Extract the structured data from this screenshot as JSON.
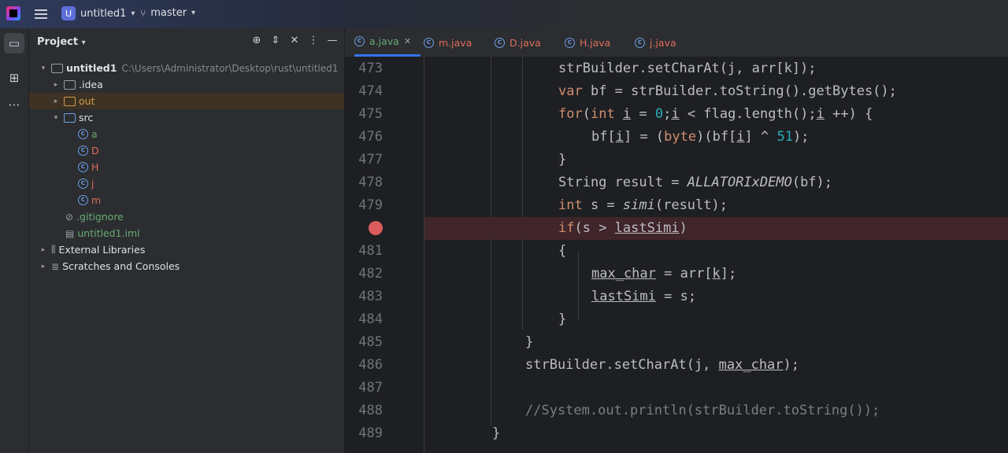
{
  "titlebar": {
    "project_badge": "U",
    "project_name": "untitled1",
    "branch": "master"
  },
  "project_panel": {
    "title": "Project",
    "tree": [
      {
        "label": "untitled1",
        "path": "C:\\Users\\Administrator\\Desktop\\rust\\untitled1",
        "icon": "module-folder-icon",
        "color": "#dfe1e5"
      },
      {
        "label": ".idea",
        "icon": "folder-icon",
        "color": "#dfe1e5"
      },
      {
        "label": "out",
        "icon": "excluded-folder-icon",
        "color": "#d19a4b"
      },
      {
        "label": "src",
        "icon": "source-folder-icon",
        "color": "#dfe1e5"
      },
      {
        "label": "a",
        "icon": "class-icon",
        "color": "#6aab73"
      },
      {
        "label": "D",
        "icon": "class-icon",
        "color": "#e06c5c"
      },
      {
        "label": "H",
        "icon": "class-icon",
        "color": "#e06c5c"
      },
      {
        "label": "j",
        "icon": "class-icon",
        "color": "#e06c5c"
      },
      {
        "label": "m",
        "icon": "class-icon",
        "color": "#e06c5c"
      },
      {
        "label": ".gitignore",
        "icon": "ignore-file-icon",
        "color": "#6aab73"
      },
      {
        "label": "untitled1.iml",
        "icon": "iml-file-icon",
        "color": "#6aab73"
      },
      {
        "label": "External Libraries",
        "icon": "library-icon",
        "color": "#dfe1e5"
      },
      {
        "label": "Scratches and Consoles",
        "icon": "scratches-icon",
        "color": "#dfe1e5"
      }
    ]
  },
  "tabs": [
    {
      "label": "a.java",
      "color": "#6aab73",
      "active": true
    },
    {
      "label": "m.java",
      "color": "#e06c5c"
    },
    {
      "label": "D.java",
      "color": "#e06c5c"
    },
    {
      "label": "H.java",
      "color": "#e06c5c"
    },
    {
      "label": "j.java",
      "color": "#e06c5c"
    }
  ],
  "editor": {
    "line_numbers": [
      "473",
      "474",
      "475",
      "476",
      "477",
      "478",
      "479",
      "",
      "481",
      "482",
      "483",
      "484",
      "485",
      "486",
      "487",
      "488",
      "489"
    ],
    "breakpoint_line": "480",
    "lines": [
      "strBuilder.setCharAt(j, arr[k]);",
      "var bf = strBuilder.toString().getBytes();",
      "for(int i = 0;i < flag.length();i ++) {",
      "bf[i] = (byte)(bf[i] ^ 51);",
      "}",
      "String result = ALLATORIxDEMO(bf);",
      "int s = simi(result);",
      "if(s > lastSimi)",
      "{",
      "max_char = arr[k];",
      "lastSimi = s;",
      "}",
      "}",
      "strBuilder.setCharAt(j, max_char);",
      "",
      "//System.out.println(strBuilder.toString());",
      "}"
    ]
  }
}
